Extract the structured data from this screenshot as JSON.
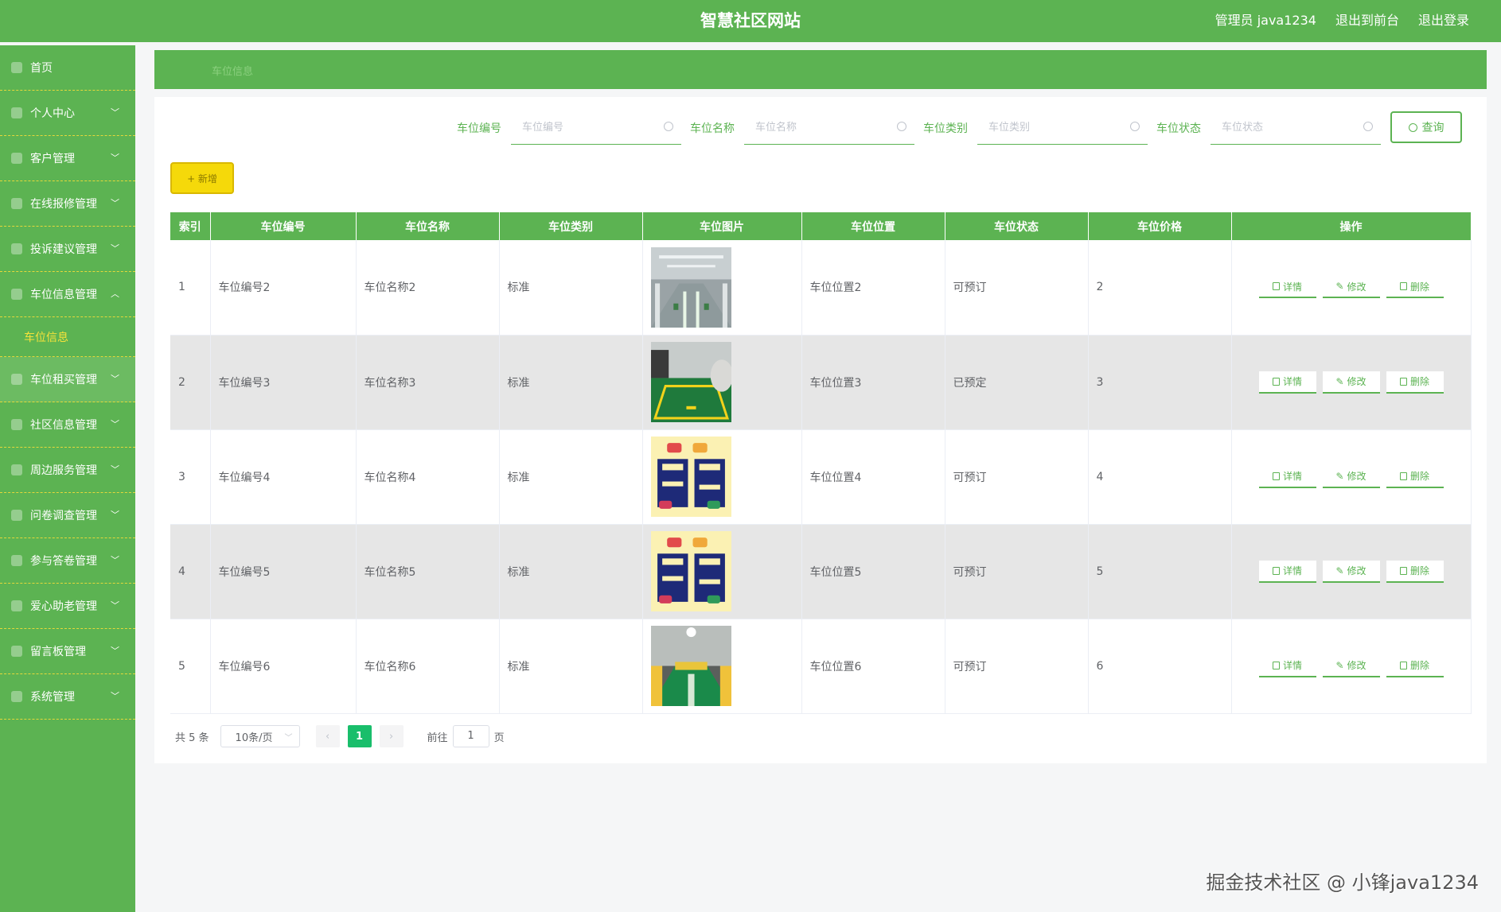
{
  "header": {
    "title": "智慧社区网站",
    "admin": "管理员 java1234",
    "to_front": "退出到前台",
    "logout": "退出登录"
  },
  "sidebar": {
    "items": [
      {
        "label": "首页",
        "icon": "home-icon"
      },
      {
        "label": "个人中心",
        "icon": "user-icon"
      },
      {
        "label": "客户管理",
        "icon": "customer-icon"
      },
      {
        "label": "在线报修管理",
        "icon": "repair-icon"
      },
      {
        "label": "投诉建议管理",
        "icon": "complaint-icon"
      },
      {
        "label": "车位信息管理",
        "icon": "parking-icon"
      },
      {
        "label": "车位租买管理",
        "icon": "rent-icon"
      },
      {
        "label": "社区信息管理",
        "icon": "community-icon"
      },
      {
        "label": "周边服务管理",
        "icon": "service-icon"
      },
      {
        "label": "问卷调查管理",
        "icon": "survey-icon"
      },
      {
        "label": "参与答卷管理",
        "icon": "answer-icon"
      },
      {
        "label": "爱心助老管理",
        "icon": "elderly-icon"
      },
      {
        "label": "留言板管理",
        "icon": "message-icon"
      },
      {
        "label": "系统管理",
        "icon": "system-icon"
      }
    ],
    "sub_active": "车位信息"
  },
  "breadcrumb": "车位信息",
  "search": {
    "fields": [
      {
        "label": "车位编号",
        "placeholder": "车位编号"
      },
      {
        "label": "车位名称",
        "placeholder": "车位名称"
      },
      {
        "label": "车位类别",
        "placeholder": "车位类别"
      },
      {
        "label": "车位状态",
        "placeholder": "车位状态"
      }
    ],
    "query_label": "查询"
  },
  "add_label": "+ 新增",
  "table": {
    "headers": [
      "索引",
      "车位编号",
      "车位名称",
      "车位类别",
      "车位图片",
      "车位位置",
      "车位状态",
      "车位价格",
      "操作"
    ],
    "rows": [
      {
        "idx": "1",
        "code": "车位编号2",
        "name": "车位名称2",
        "type": "标准",
        "img": "garage",
        "pos": "车位位置2",
        "status": "可预订",
        "price": "2"
      },
      {
        "idx": "2",
        "code": "车位编号3",
        "name": "车位名称3",
        "type": "标准",
        "img": "green-spot",
        "pos": "车位位置3",
        "status": "已预定",
        "price": "3"
      },
      {
        "idx": "3",
        "code": "车位编号4",
        "name": "车位名称4",
        "type": "标准",
        "img": "poster",
        "pos": "车位位置4",
        "status": "可预订",
        "price": "4"
      },
      {
        "idx": "4",
        "code": "车位编号5",
        "name": "车位名称5",
        "type": "标准",
        "img": "poster",
        "pos": "车位位置5",
        "status": "可预订",
        "price": "5"
      },
      {
        "idx": "5",
        "code": "车位编号6",
        "name": "车位名称6",
        "type": "标准",
        "img": "green-floor",
        "pos": "车位位置6",
        "status": "可预订",
        "price": "6"
      }
    ],
    "ops": {
      "detail": "详情",
      "edit": "修改",
      "delete": "删除"
    }
  },
  "pager": {
    "total": "共 5 条",
    "size": "10条/页",
    "page": "1",
    "goto": "前往",
    "goto_value": "1",
    "page_suffix": "页"
  },
  "watermark": "掘金技术社区 @ 小锋java1234",
  "colors": {
    "primary": "#5cb352",
    "accent_yellow": "#f5d90a",
    "page_green": "#19be6b"
  }
}
